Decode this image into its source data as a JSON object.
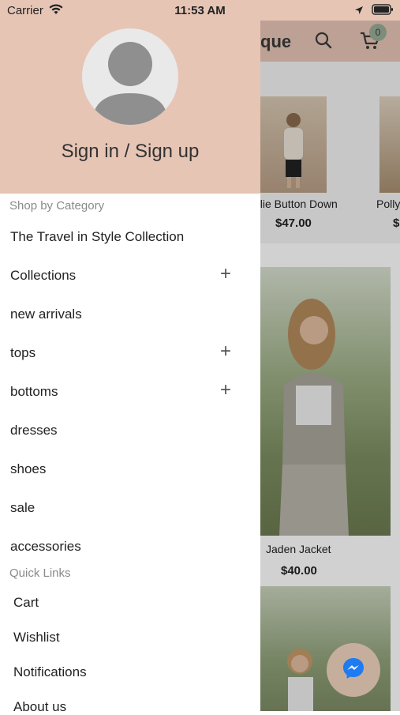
{
  "status_bar": {
    "carrier": "Carrier",
    "time": "11:53 AM"
  },
  "app": {
    "title": "que",
    "cart_count": "0",
    "products_top": [
      {
        "name": "nlie Button Down",
        "price": "$47.00"
      },
      {
        "name": "Polly",
        "price": "$"
      }
    ],
    "product_main": {
      "name": "Jaden Jacket",
      "price": "$40.00"
    }
  },
  "drawer": {
    "signin": "Sign in / Sign up",
    "shop_label": "Shop by Category",
    "categories": [
      {
        "label": "The Travel in Style Collection",
        "expandable": false
      },
      {
        "label": "Collections",
        "expandable": true
      },
      {
        "label": "new arrivals",
        "expandable": false
      },
      {
        "label": "tops",
        "expandable": true
      },
      {
        "label": "bottoms",
        "expandable": true
      },
      {
        "label": "dresses",
        "expandable": false
      },
      {
        "label": "shoes",
        "expandable": false
      },
      {
        "label": "sale",
        "expandable": false
      },
      {
        "label": "accessories",
        "expandable": false
      }
    ],
    "quick_label": "Quick Links",
    "quick_links": [
      "Cart",
      "Wishlist",
      "Notifications",
      "About us"
    ]
  },
  "colors": {
    "accent": "#e6c5b5",
    "badge": "#99ad96",
    "messenger": "#c6ae9c"
  },
  "icons": [
    "wifi-icon",
    "location-arrow-icon",
    "battery-icon",
    "search-icon",
    "cart-icon",
    "user-avatar-icon",
    "plus-icon",
    "messenger-icon"
  ]
}
